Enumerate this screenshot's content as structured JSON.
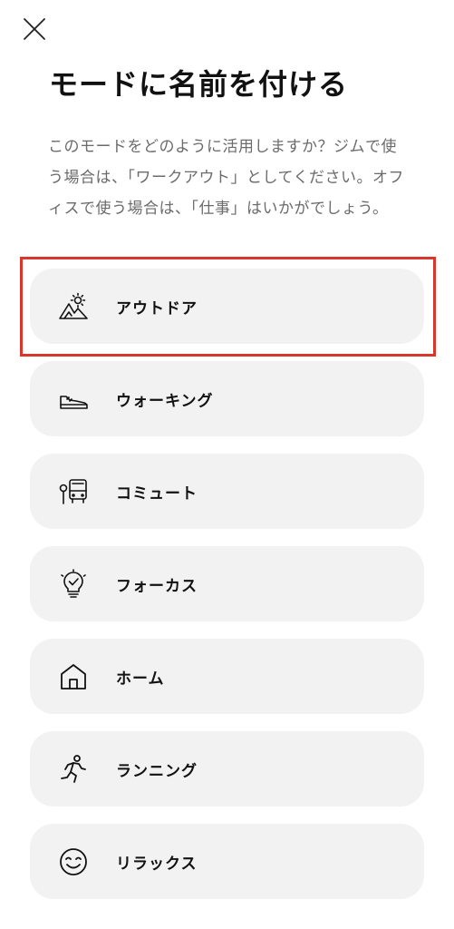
{
  "header": {
    "close_icon": "close-icon",
    "title": "モードに名前を付ける"
  },
  "description": "このモードをどのように活用しますか？ジムで使う場合は、「ワークアウト」としてください。オフィスで使う場合は、「仕事」はいかがでしょう。",
  "modes": [
    {
      "label": "アウトドア",
      "icon": "outdoor-mountain-sun-icon",
      "selected": true
    },
    {
      "label": "ウォーキング",
      "icon": "sneaker-icon"
    },
    {
      "label": "コミュート",
      "icon": "bus-stop-icon"
    },
    {
      "label": "フォーカス",
      "icon": "lightbulb-check-icon"
    },
    {
      "label": "ホーム",
      "icon": "house-icon"
    },
    {
      "label": "ランニング",
      "icon": "runner-icon"
    },
    {
      "label": "リラックス",
      "icon": "smile-icon"
    }
  ],
  "colors": {
    "highlight_border": "#d9372b",
    "item_background": "#f2f2f2",
    "description_text": "#6b6b6b"
  }
}
